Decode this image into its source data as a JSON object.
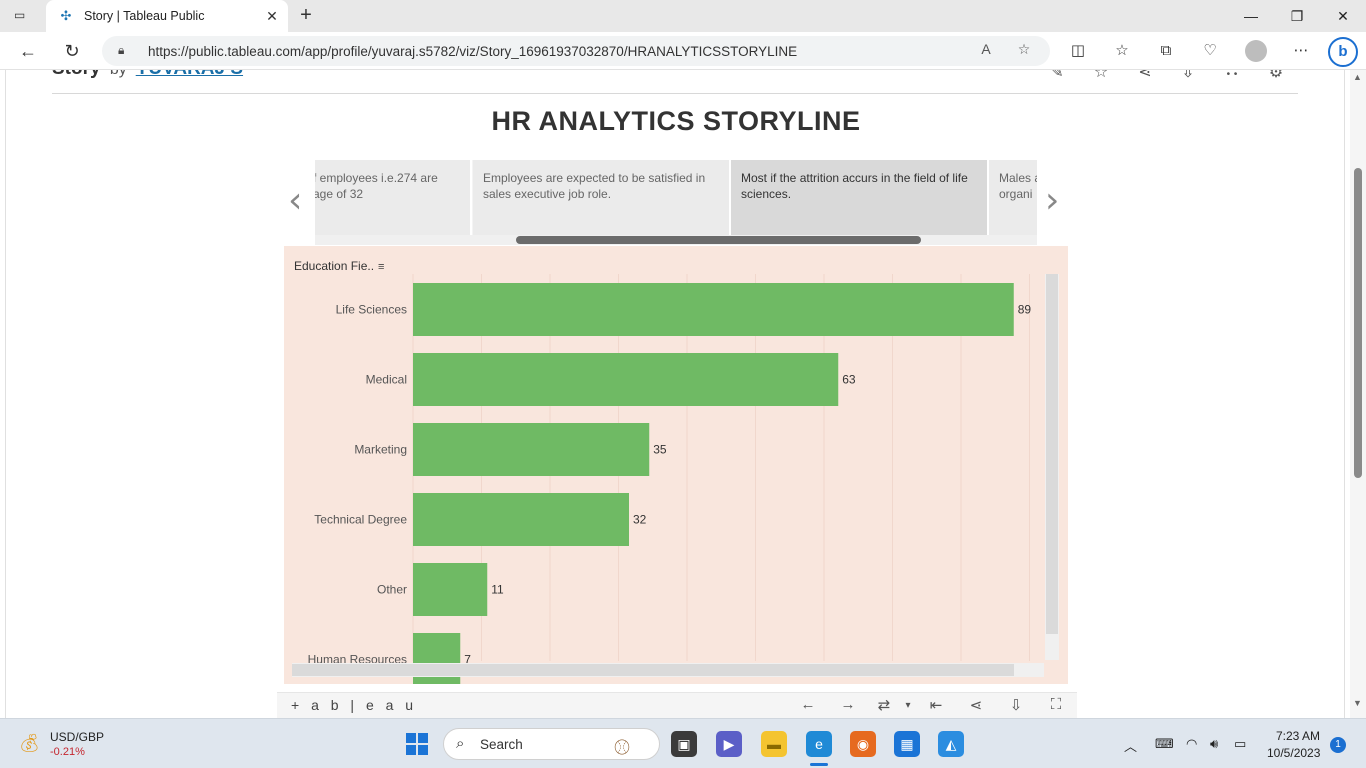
{
  "browser": {
    "tab_title": "Story | Tableau Public",
    "url": "https://public.tableau.com/app/profile/yuvaraj.s5782/viz/Story_16961937032870/HRANALYTICSSTORYLINE"
  },
  "story": {
    "label": "Story",
    "by": "by",
    "author": "YUVARAJ S",
    "dashboard_title": "HR ANALYTICS STORYLINE",
    "points": [
      "f employees i.e.274 are\n age of 32",
      "Employees are expected to be satisfied in sales executive job role.",
      "Most if the attrition accurs in the field of life sciences.",
      "Males a\norgani"
    ],
    "active_point": 2
  },
  "chart_header": "Education Fie..",
  "chart_data": {
    "type": "bar",
    "orientation": "horizontal",
    "categories": [
      "Life Sciences",
      "Medical",
      "Marketing",
      "Technical Degree",
      "Other",
      "Human Resources"
    ],
    "values": [
      89,
      63,
      35,
      32,
      11,
      7
    ],
    "xlim": [
      0,
      92
    ],
    "grid": true,
    "bar_color": "#6fba64",
    "background": "#f9e6dd"
  },
  "tableau_toolbar": {
    "logo_text": "+ a b | e a u"
  },
  "taskbar": {
    "ticker_name": "USD/GBP",
    "ticker_change": "-0.21%",
    "search_placeholder": "Search",
    "time": "7:23 AM",
    "date": "10/5/2023",
    "notification_count": "1"
  },
  "colors": {
    "accent": "#1b74d6",
    "bar": "#6fba64",
    "chart_bg": "#f9e6dd"
  }
}
